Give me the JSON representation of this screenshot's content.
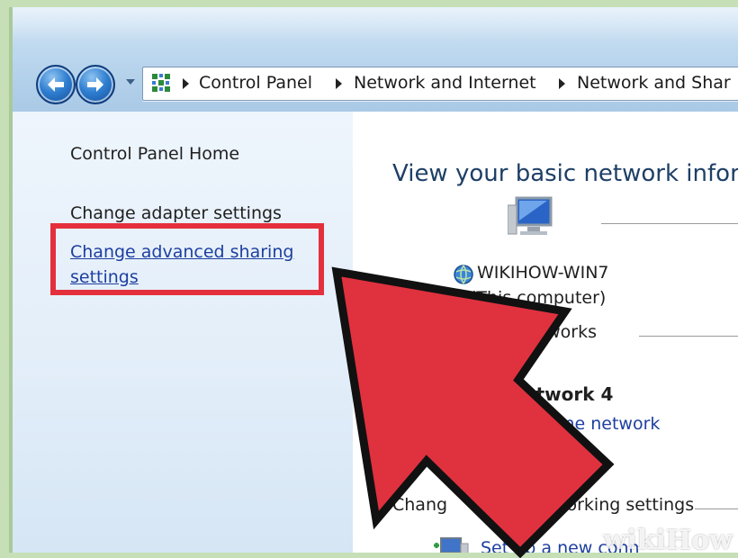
{
  "breadcrumb": {
    "items": [
      "Control Panel",
      "Network and Internet",
      "Network and Shar"
    ]
  },
  "sidebar": {
    "home": "Control Panel Home",
    "adapter": "Change adapter settings",
    "advanced_line1": "Change advanced sharing",
    "advanced_line2": "settings"
  },
  "main": {
    "title": "View your basic network inform",
    "computer_name": "WIKIHOW-WIN7",
    "computer_sub": "(This computer)",
    "active_networks_label": "etworks",
    "network_name": "etwork 4",
    "network_type": "me network",
    "change_settings_label_a": "Chang",
    "change_settings_label_b": "your networking settings",
    "setup_connection": "Set up a new conn"
  },
  "watermark": "wikiHow",
  "colors": {
    "highlight": "#e4303d",
    "arrow": "#e0313f",
    "link": "#1d3fa0",
    "title": "#1e3f66"
  }
}
